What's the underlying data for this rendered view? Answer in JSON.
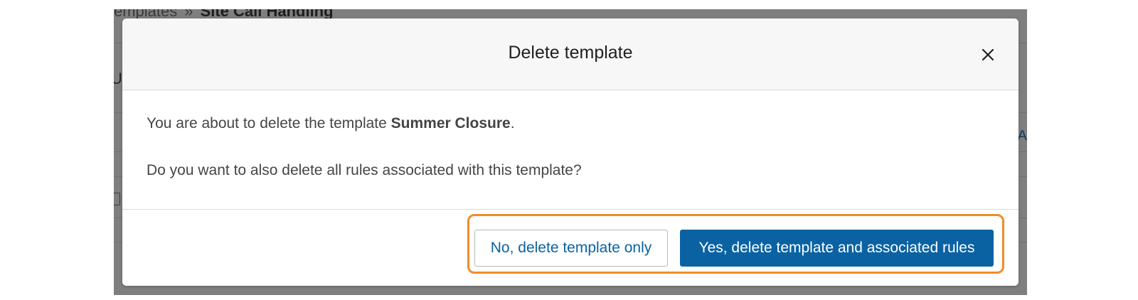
{
  "background": {
    "breadcrumb_prev": "emplates",
    "breadcrumb_separator": "»",
    "breadcrumb_current": "Site Call Handling",
    "left_partial_text": "U",
    "right_partial_text": "A"
  },
  "modal": {
    "title": "Delete template",
    "close_icon": "close-icon",
    "message_prefix": "You are about to delete the template ",
    "template_name": "Summer Closure",
    "message_suffix": ".",
    "question": "Do you want to also delete all rules associated with this template?",
    "secondary_button": "No, delete template only",
    "primary_button": "Yes, delete template and associated rules"
  },
  "colors": {
    "primary": "#0a62a3",
    "highlight": "#f28c28",
    "overlay": "#7d7d7d"
  }
}
